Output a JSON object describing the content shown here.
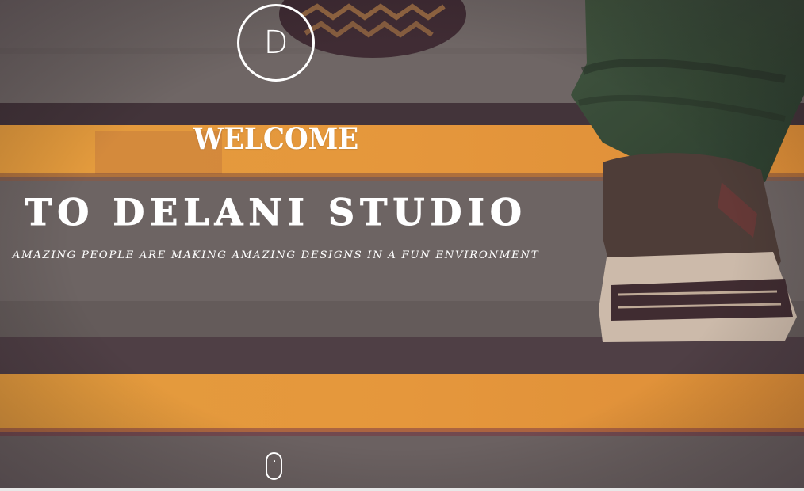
{
  "brand": {
    "logo_letter": "D"
  },
  "hero": {
    "welcome": "WELCOME",
    "title": "TO DELANI STUDIO",
    "tagline": "AMAZING PEOPLE ARE MAKING AMAZING DESIGNS IN A FUN ENVIRONMENT"
  },
  "scroll_hint": {
    "icon": "mouse-scroll-icon"
  },
  "colors": {
    "text": "#ffffff",
    "stair_stripe": "#f3a33a",
    "concrete": "#6b6966",
    "jeans": "#2f4a32",
    "shoe_upper": "#4a3f36",
    "sole": "#d8cdb8"
  }
}
